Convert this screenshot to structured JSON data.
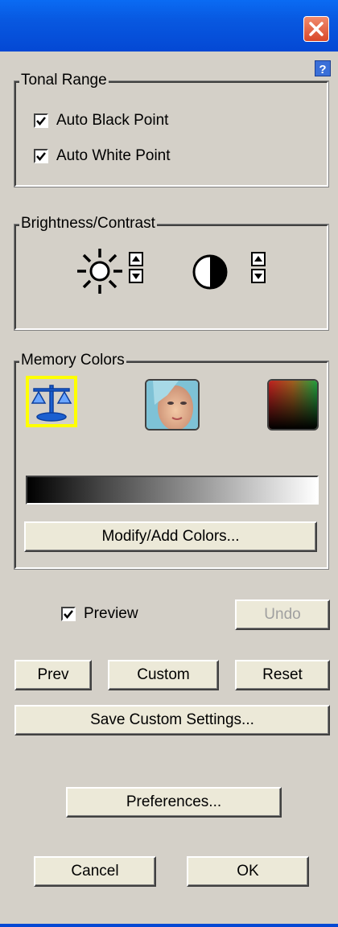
{
  "window": {
    "title": "",
    "close_icon": "close-icon",
    "help_icon": "help-icon"
  },
  "tonal_range": {
    "title": "Tonal Range",
    "auto_black_point": {
      "label": "Auto Black Point",
      "checked": true
    },
    "auto_white_point": {
      "label": "Auto White Point",
      "checked": true
    }
  },
  "brightness_contrast": {
    "title": "Brightness/Contrast",
    "brightness_icon": "sun-icon",
    "contrast_icon": "contrast-icon"
  },
  "memory_colors": {
    "title": "Memory Colors",
    "icons": [
      "balance-scale-icon",
      "face-portrait-icon",
      "color-gradient-icon"
    ],
    "modify_label": "Modify/Add Colors..."
  },
  "preview": {
    "label": "Preview",
    "checked": true
  },
  "buttons": {
    "undo": "Undo",
    "prev": "Prev",
    "custom": "Custom",
    "reset": "Reset",
    "save_custom": "Save Custom Settings...",
    "preferences": "Preferences...",
    "cancel": "Cancel",
    "ok": "OK"
  },
  "colors": {
    "titlebar": "#0858e0",
    "dialog_bg": "#d4d0c8",
    "button_bg": "#ece9d8",
    "selection_border": "#ffff00"
  }
}
